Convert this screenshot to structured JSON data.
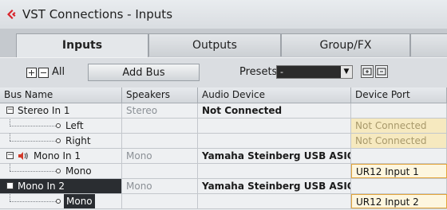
{
  "window": {
    "title": "VST Connections - Inputs"
  },
  "tabs": [
    {
      "label": "Inputs",
      "active": true
    },
    {
      "label": "Outputs",
      "active": false
    },
    {
      "label": "Group/FX",
      "active": false
    }
  ],
  "toolbar": {
    "all_label": "All",
    "add_bus_label": "Add Bus",
    "presets_label": "Presets",
    "presets_value": "-"
  },
  "columns": [
    "Bus Name",
    "Speakers",
    "Audio Device",
    "Device Port"
  ],
  "rows": [
    {
      "name": "Stereo In 1",
      "speakers": "Stereo",
      "device": "Not Connected",
      "port": ""
    },
    {
      "name": "Left",
      "speakers": "",
      "device": "",
      "port": "Not Connected"
    },
    {
      "name": "Right",
      "speakers": "",
      "device": "",
      "port": "Not Connected"
    },
    {
      "name": "Mono In 1",
      "speakers": "Mono",
      "device": "Yamaha Steinberg USB ASIO",
      "port": ""
    },
    {
      "name": "Mono",
      "speakers": "",
      "device": "",
      "port": "UR12 Input 1"
    },
    {
      "name": "Mono In 2",
      "speakers": "Mono",
      "device": "Yamaha Steinberg USB ASIO",
      "port": ""
    },
    {
      "name": "Mono",
      "speakers": "",
      "device": "",
      "port": "UR12 Input 2"
    }
  ],
  "colors": {
    "accent_orange": "#e3a53a",
    "not_connected_bg": "#f6e9bf",
    "selection_bg": "#2a2d31"
  }
}
